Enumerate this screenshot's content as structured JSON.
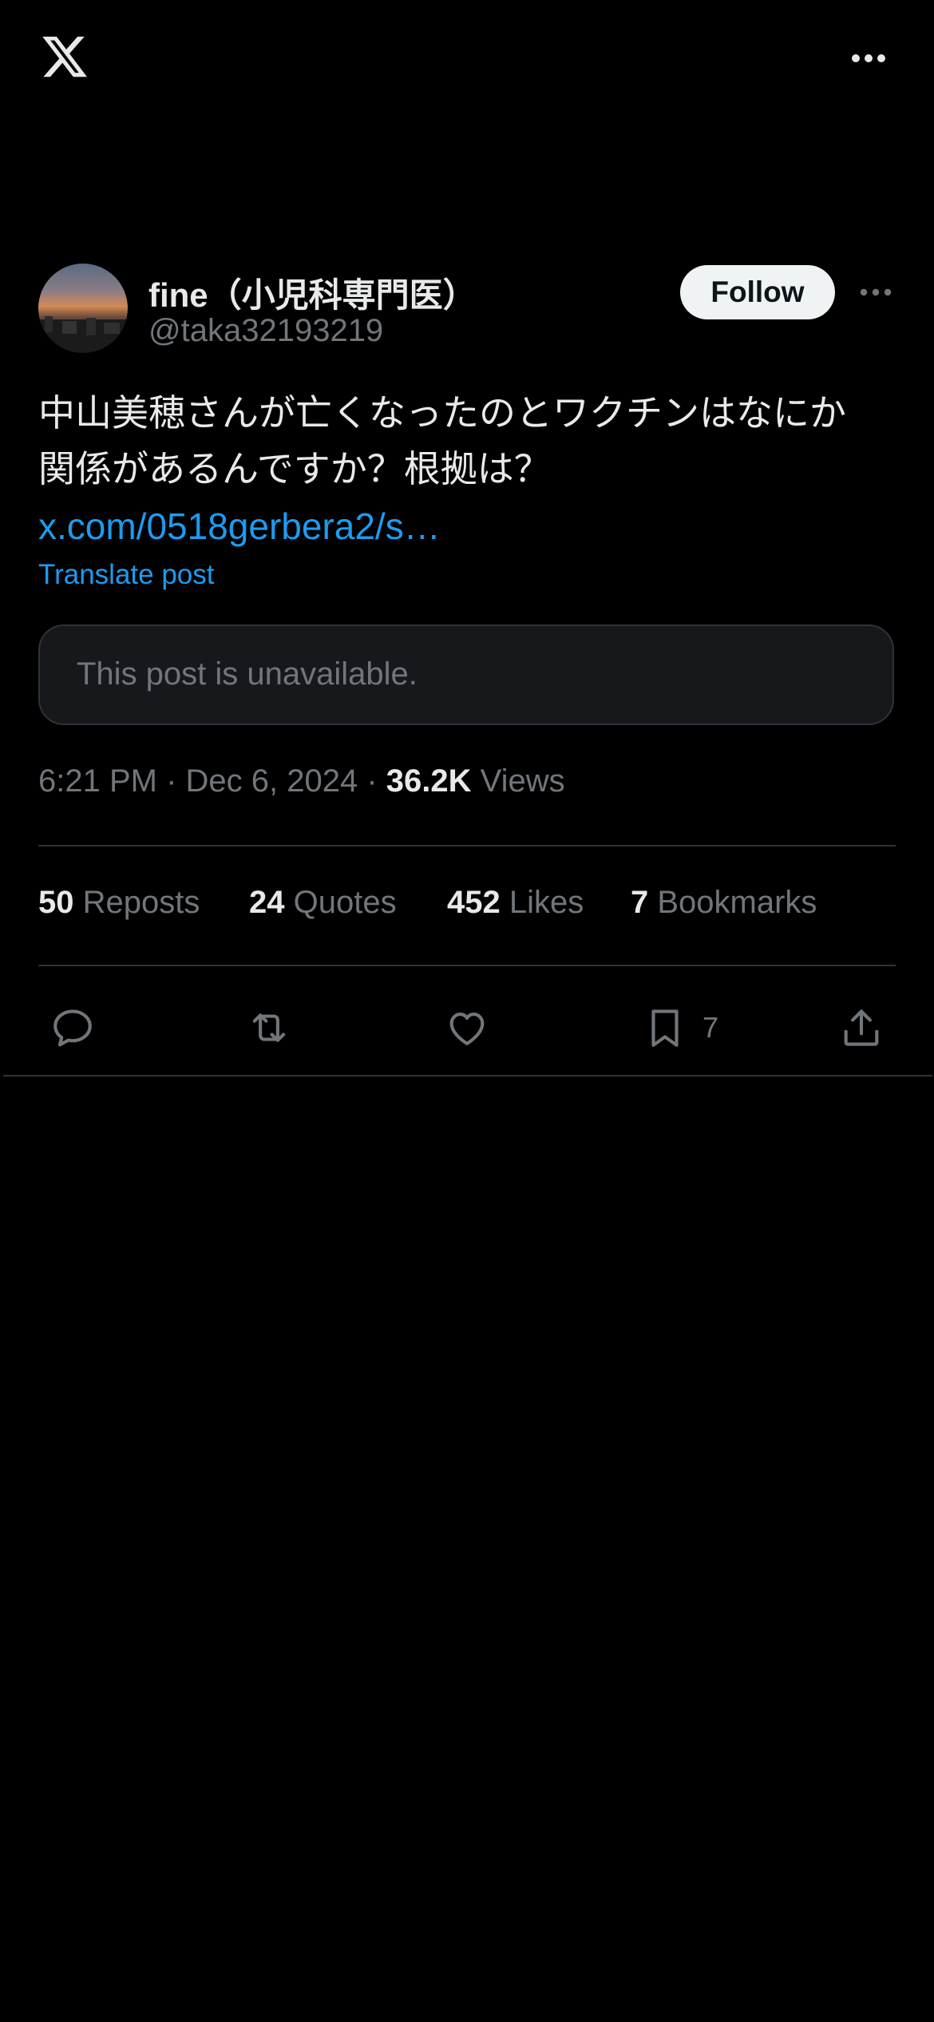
{
  "header": {
    "logo_icon": "x-logo-icon",
    "more_icon": "more-horizontal-icon"
  },
  "post": {
    "author": {
      "display_name": "fine（小児科専門医）",
      "handle": "@taka32193219",
      "avatar_icon": "avatar-image"
    },
    "follow_label": "Follow",
    "text": "中山美穂さんが亡くなったのとワクチンはなにか\n関係があるんですか？根拠は？",
    "link": "x.com/0518gerbera2/s…",
    "translate_label": "Translate post",
    "quoted_unavailable": "This post is unavailable.",
    "time": "6:21 PM",
    "date": "Dec 6, 2024",
    "views_count": "36.2K",
    "views_label": "Views",
    "separator": " · "
  },
  "stats": {
    "reposts": {
      "count": "50",
      "label": "Reposts"
    },
    "quotes": {
      "count": "24",
      "label": "Quotes"
    },
    "likes": {
      "count": "452",
      "label": "Likes"
    },
    "bookmarks": {
      "count": "7",
      "label": "Bookmarks"
    }
  },
  "actions": {
    "reply_icon": "reply-icon",
    "repost_icon": "repost-icon",
    "like_icon": "heart-icon",
    "bookmark_icon": "bookmark-icon",
    "bookmark_count": "7",
    "share_icon": "share-icon"
  },
  "colors": {
    "background": "#000000",
    "text_primary": "#e7e9ea",
    "text_secondary": "#71767b",
    "accent": "#1d9bf0",
    "divider": "#2f3336",
    "follow_bg": "#eff3f4"
  }
}
